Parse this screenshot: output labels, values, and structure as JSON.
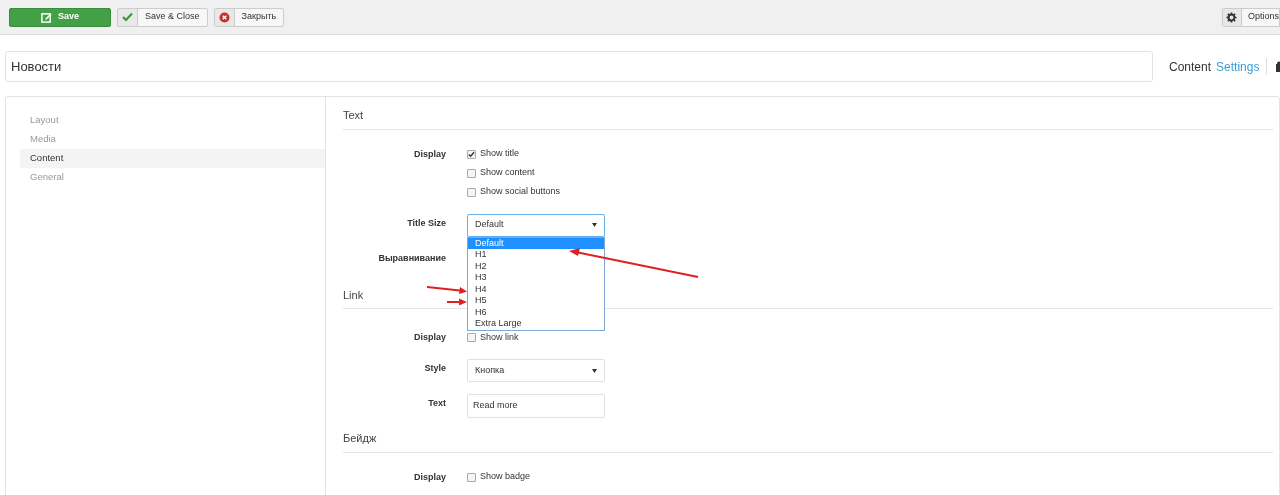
{
  "toolbar": {
    "buttons": [
      {
        "label": "Save",
        "kind": "primary"
      },
      {
        "label": "Save & Close",
        "kind": "confirm"
      },
      {
        "label": "Закрыть",
        "kind": "cancel"
      }
    ],
    "options": {
      "label": "Options"
    }
  },
  "title_field": {
    "value": "Новости"
  },
  "header_links": [
    {
      "label": "Content",
      "selected": true
    },
    {
      "label": "Settings",
      "selected": false
    }
  ],
  "sidebar": {
    "items": [
      {
        "label": "Layout",
        "selected": false
      },
      {
        "label": "Media",
        "selected": false
      },
      {
        "label": "Content",
        "selected": true
      },
      {
        "label": "General",
        "selected": false
      }
    ]
  },
  "sections": [
    {
      "title": "Text",
      "fields": [
        {
          "label": "Display",
          "kind": "checkboxes",
          "options": [
            {
              "label": "Show title",
              "checked": true
            },
            {
              "label": "Show content",
              "checked": false
            },
            {
              "label": "Show social buttons",
              "checked": false
            }
          ]
        },
        {
          "label": "Title Size",
          "kind": "select",
          "value": "Default",
          "expanded": true,
          "options": [
            {
              "label": "Default",
              "selected": true
            },
            {
              "label": "H1",
              "selected": false
            },
            {
              "label": "H2",
              "selected": false
            },
            {
              "label": "H3",
              "selected": false
            },
            {
              "label": "H4",
              "selected": false
            },
            {
              "label": "H5",
              "selected": false
            },
            {
              "label": "H6",
              "selected": false
            },
            {
              "label": "Extra Large",
              "selected": false
            }
          ]
        },
        {
          "label": "Выравнивание",
          "kind": "covered"
        }
      ]
    },
    {
      "title": "Link",
      "fields": [
        {
          "label": "Display",
          "kind": "checkboxes",
          "options": [
            {
              "label": "Show link",
              "checked": false
            }
          ]
        },
        {
          "label": "Style",
          "kind": "select",
          "value": "Кнопка",
          "expanded": false
        },
        {
          "label": "Text",
          "kind": "text",
          "value": "Read more"
        }
      ]
    },
    {
      "title": "Бейдж",
      "fields": [
        {
          "label": "Display",
          "kind": "checkboxes",
          "options": [
            {
              "label": "Show badge",
              "checked": false
            }
          ]
        }
      ]
    }
  ]
}
